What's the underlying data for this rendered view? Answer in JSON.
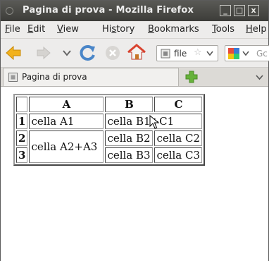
{
  "window": {
    "title": "Pagina di prova - Mozilla Firefox",
    "controls": {
      "minimize": "_",
      "maximize": "□",
      "close": "x"
    }
  },
  "menubar": {
    "items": [
      {
        "pre": "",
        "accel": "F",
        "post": "ile"
      },
      {
        "pre": "",
        "accel": "E",
        "post": "dit"
      },
      {
        "pre": "",
        "accel": "V",
        "post": "iew"
      },
      {
        "pre": "Hi",
        "accel": "s",
        "post": "tory"
      },
      {
        "pre": "",
        "accel": "B",
        "post": "ookmarks"
      },
      {
        "pre": "",
        "accel": "T",
        "post": "ools"
      },
      {
        "pre": "",
        "accel": "H",
        "post": "elp"
      }
    ]
  },
  "navbar": {
    "url_text": "file",
    "search_placeholder": "Gc"
  },
  "tab": {
    "label": "Pagina di prova"
  },
  "table": {
    "headers": [
      "A",
      "B",
      "C"
    ],
    "rownums": [
      "1",
      "2",
      "3"
    ],
    "cells": {
      "a1": "cella A1",
      "b1c1": "cella B1+C1",
      "a2a3": "cella A2+A3",
      "b2": "cella B2",
      "c2": "cella C2",
      "b3": "cella B3",
      "c3": "cella C3"
    }
  },
  "colors": {
    "titlebar": "#3c3c39",
    "chrome": "#edeceb",
    "back_arrow": "#f2b21c",
    "reload": "#4a86c8",
    "newtab_plus": "#66b23a"
  },
  "icons": [
    "back-arrow-icon",
    "forward-arrow-icon",
    "history-dropdown-icon",
    "reload-icon",
    "stop-icon",
    "home-icon",
    "page-icon",
    "star-icon",
    "search-engine-icon",
    "new-tab-icon",
    "tab-list-icon",
    "mouse-cursor-icon"
  ]
}
